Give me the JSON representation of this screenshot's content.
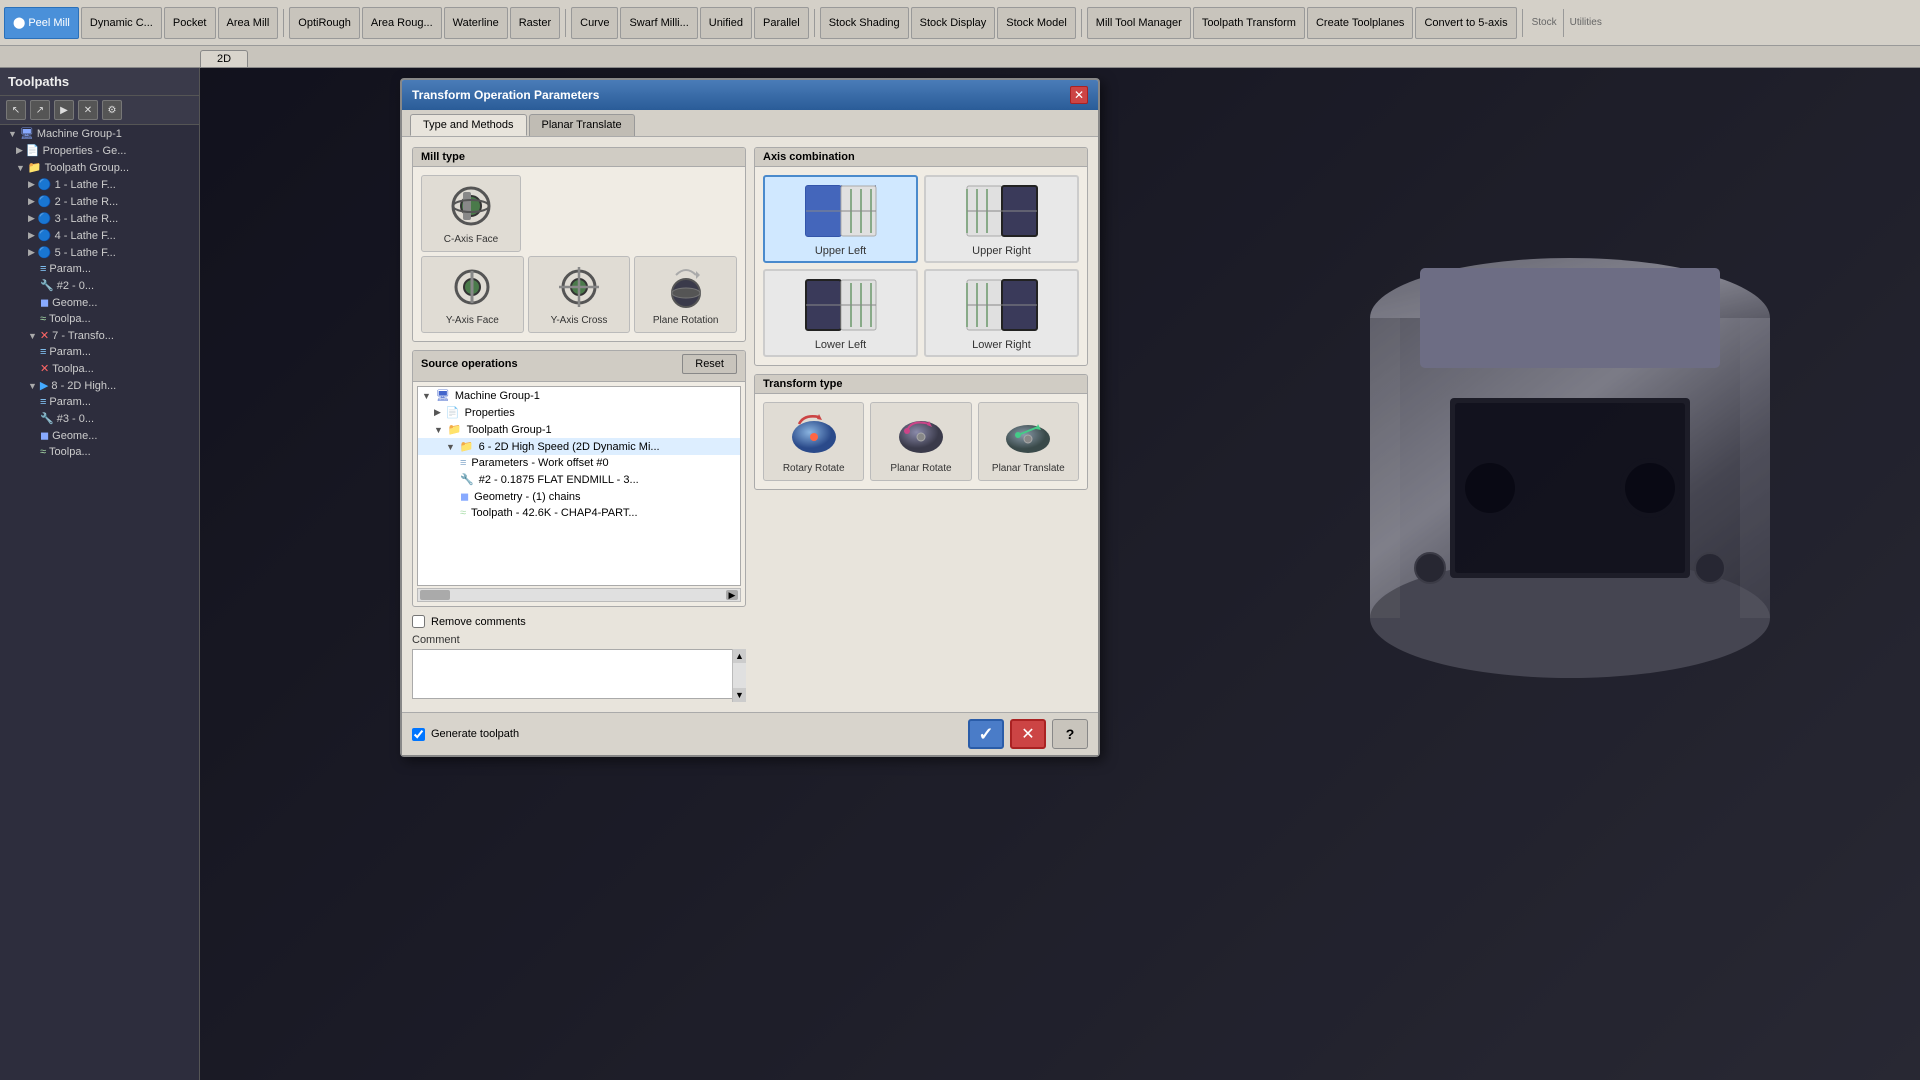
{
  "toolbar": {
    "buttons": [
      {
        "id": "dynamic-c",
        "label": "Dynamic C...",
        "active": false
      },
      {
        "id": "pocket",
        "label": "Pocket",
        "active": false
      },
      {
        "id": "peel-mill",
        "label": "Peel Mill",
        "active": true
      },
      {
        "id": "area-mill",
        "label": "Area Mill",
        "active": false
      },
      {
        "id": "optrough",
        "label": "OptiRough",
        "active": false
      },
      {
        "id": "area-rough",
        "label": "Area Roug...",
        "active": false
      },
      {
        "id": "waterline",
        "label": "Waterline",
        "active": false
      },
      {
        "id": "raster",
        "label": "Raster",
        "active": false
      },
      {
        "id": "curve",
        "label": "Curve",
        "active": false
      },
      {
        "id": "swarf-mill",
        "label": "Swarf Milli...",
        "active": false
      },
      {
        "id": "unified",
        "label": "Unified",
        "active": false
      },
      {
        "id": "parallel",
        "label": "Parallel",
        "active": false
      }
    ],
    "stock_group": {
      "buttons": [
        "Stock Shading",
        "Stock Display",
        "Stock Model"
      ]
    },
    "utilities_group": {
      "buttons": [
        "Mill Tool Manager",
        "Toolpath Transform",
        "Create Toolplanes",
        "Convert to 5-axis"
      ]
    }
  },
  "tab_row": {
    "tabs": [
      "2D"
    ]
  },
  "sidebar": {
    "title": "Toolpaths",
    "tree": [
      {
        "id": "machine-group",
        "label": "Machine Group-1",
        "indent": 0,
        "icon": "group"
      },
      {
        "id": "properties",
        "label": "Properties - Ge...",
        "indent": 1,
        "icon": "props"
      },
      {
        "id": "toolpath-group",
        "label": "Toolpath Group...",
        "indent": 1,
        "icon": "folder"
      },
      {
        "id": "lathe1",
        "label": "1 - Lathe F...",
        "indent": 2,
        "icon": "op"
      },
      {
        "id": "lathe2",
        "label": "2 - Lathe R...",
        "indent": 2,
        "icon": "op"
      },
      {
        "id": "lathe3",
        "label": "3 - Lathe R...",
        "indent": 2,
        "icon": "op"
      },
      {
        "id": "lathe4",
        "label": "4 - Lathe F...",
        "indent": 2,
        "icon": "op"
      },
      {
        "id": "lathe5",
        "label": "5 - Lathe F...",
        "indent": 2,
        "icon": "op"
      },
      {
        "id": "param1",
        "label": "Param...",
        "indent": 3,
        "icon": "param"
      },
      {
        "id": "param2",
        "label": "#2 - 0...",
        "indent": 3,
        "icon": "param"
      },
      {
        "id": "geom1",
        "label": "Geome...",
        "indent": 3,
        "icon": "geom"
      },
      {
        "id": "tool1",
        "label": "Toolpa...",
        "indent": 3,
        "icon": "tool"
      },
      {
        "id": "transform7",
        "label": "7 - Transfo...",
        "indent": 2,
        "icon": "transform"
      },
      {
        "id": "param-t",
        "label": "Param...",
        "indent": 3,
        "icon": "param"
      },
      {
        "id": "toolpath-t",
        "label": "Toolpa...",
        "indent": 3,
        "icon": "tool"
      },
      {
        "id": "op8",
        "label": "8 - 2D High...",
        "indent": 2,
        "icon": "op"
      },
      {
        "id": "param-8",
        "label": "Param...",
        "indent": 3,
        "icon": "param"
      },
      {
        "id": "param3",
        "label": "#3 - 0...",
        "indent": 3,
        "icon": "param"
      },
      {
        "id": "geom2",
        "label": "Geome...",
        "indent": 3,
        "icon": "geom"
      },
      {
        "id": "tool2",
        "label": "Toolpa...",
        "indent": 3,
        "icon": "tool"
      }
    ]
  },
  "dialog": {
    "title": "Transform Operation Parameters",
    "tabs": [
      "Type and Methods",
      "Planar Translate"
    ],
    "active_tab": "Type and Methods",
    "mill_type": {
      "label": "Mill type",
      "items": [
        {
          "id": "c-axis-face",
          "label": "C-Axis Face"
        },
        {
          "id": "y-axis-face",
          "label": "Y-Axis Face"
        },
        {
          "id": "y-axis-cross",
          "label": "Y-Axis Cross"
        },
        {
          "id": "plane-rotation",
          "label": "Plane Rotation"
        }
      ]
    },
    "axis_combination": {
      "label": "Axis combination",
      "items": [
        {
          "id": "upper-left",
          "label": "Upper Left",
          "selected": true
        },
        {
          "id": "upper-right",
          "label": "Upper Right"
        },
        {
          "id": "lower-left",
          "label": "Lower Left"
        },
        {
          "id": "lower-right",
          "label": "Lower Right"
        }
      ]
    },
    "source_operations": {
      "label": "Source operations",
      "reset_label": "Reset",
      "tree": [
        {
          "id": "mg1",
          "label": "Machine Group-1",
          "indent": 0
        },
        {
          "id": "props",
          "label": "Properties",
          "indent": 1
        },
        {
          "id": "tg1",
          "label": "Toolpath Group-1",
          "indent": 1
        },
        {
          "id": "op6",
          "label": "6 - 2D High Speed (2D Dynamic Mi...",
          "indent": 2
        },
        {
          "id": "op6-param",
          "label": "Parameters - Work offset #0",
          "indent": 3
        },
        {
          "id": "op6-tool",
          "label": "#2 - 0.1875 FLAT ENDMILL - 3...",
          "indent": 3
        },
        {
          "id": "op6-geom",
          "label": "Geometry - (1) chains",
          "indent": 3
        },
        {
          "id": "op6-path",
          "label": "Toolpath - 42.6K - CHAP4-PART...",
          "indent": 3
        }
      ]
    },
    "transform_type": {
      "label": "Transform type",
      "items": [
        {
          "id": "rotary-rotate",
          "label": "Rotary Rotate",
          "selected": false
        },
        {
          "id": "planar-rotate",
          "label": "Planar Rotate"
        },
        {
          "id": "planar-translate",
          "label": "Planar Translate",
          "selected": false
        }
      ]
    },
    "remove_comments": {
      "label": "Remove comments",
      "checked": false
    },
    "comment": {
      "label": "Comment",
      "value": ""
    },
    "footer": {
      "generate_toolpath_label": "Generate toolpath",
      "generate_checked": true,
      "ok_label": "✓",
      "cancel_label": "✕",
      "help_label": "?"
    }
  }
}
